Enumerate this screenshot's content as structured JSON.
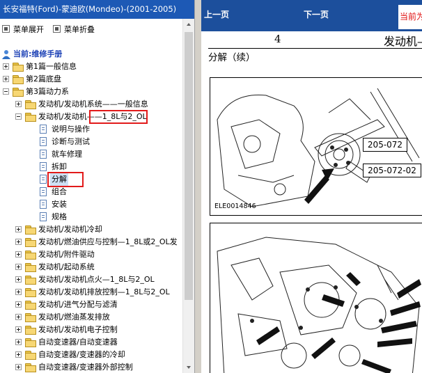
{
  "left_panel": {
    "title": "长安福特(Ford)-蒙迪欧(Mondeo)-(2001-2005)",
    "toolbar": {
      "expand_label": "菜单展开",
      "collapse_label": "菜单折叠"
    },
    "tree": {
      "root_label": "当前:维修手册",
      "items": [
        {
          "label": "第1篇一般信息"
        },
        {
          "label": "第2篇底盘"
        },
        {
          "label": "第3篇动力系"
        },
        {
          "label": "发动机/发动机系统——一般信息"
        },
        {
          "label": "发动机/发动机——1_8L与2_OL"
        },
        {
          "label": "说明与操作"
        },
        {
          "label": "诊断与测试"
        },
        {
          "label": "就车修理"
        },
        {
          "label": "拆卸"
        },
        {
          "label": "分解"
        },
        {
          "label": "组合"
        },
        {
          "label": "安装"
        },
        {
          "label": "规格"
        },
        {
          "label": "发动机/发动机冷却"
        },
        {
          "label": "发动机/燃油供应与控制—1_8L或2_OL发"
        },
        {
          "label": "发动机/附件驱动"
        },
        {
          "label": "发动机/起动系统"
        },
        {
          "label": "发动机/发动机点火—1_8L与2_OL"
        },
        {
          "label": "发动机/发动机排放控制—1_8L与2_OL"
        },
        {
          "label": "发动机/进气分配与滤清"
        },
        {
          "label": "发动机/燃油蒸发排放"
        },
        {
          "label": "发动机/发动机电子控制"
        },
        {
          "label": "自动变速器/自动变速器"
        },
        {
          "label": "自动变速器/变速器的冷却"
        },
        {
          "label": "自动变速器/变速器外部控制"
        }
      ]
    }
  },
  "right_panel": {
    "nav": {
      "prev_label": "上一页",
      "next_label": "下一页",
      "current_label": "当前为"
    },
    "page": {
      "number": "4",
      "chapter": "发动机—",
      "subtitle": "分解（续）",
      "figure1": {
        "callout_a": "205-072",
        "callout_b": "205-072-02",
        "figure_code": "ELE0014846"
      }
    }
  },
  "colors": {
    "title_bar": "#1d59b5",
    "nav_bar": "#1c4f9c",
    "highlight_box": "#e21a1a",
    "current_text": "#e01010"
  }
}
